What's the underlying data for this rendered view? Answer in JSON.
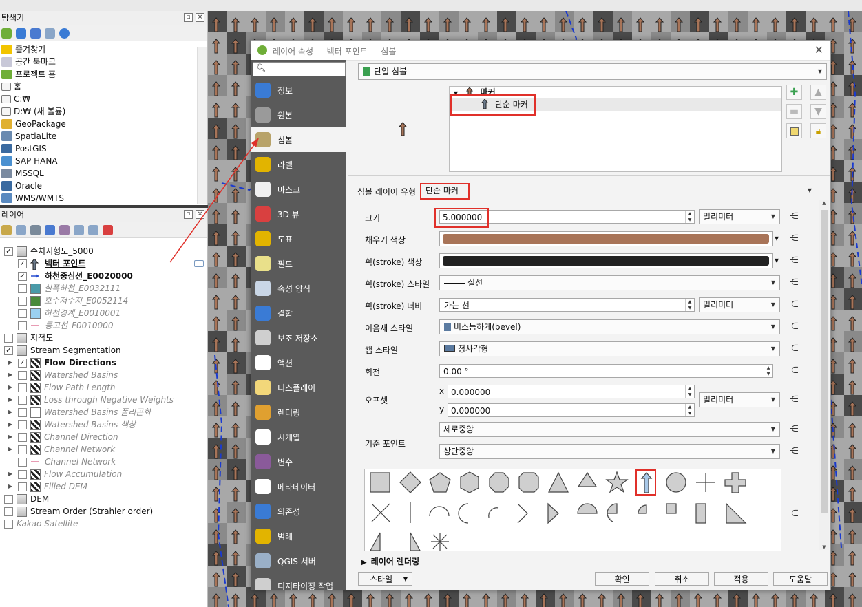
{
  "browser_panel": {
    "title": "탐색기",
    "items": [
      {
        "label": "즐겨찾기",
        "icon": "star-icon"
      },
      {
        "label": "공간 북마크",
        "icon": "bookmark-icon"
      },
      {
        "label": "프로젝트 홈",
        "icon": "project-home-icon"
      },
      {
        "label": "홈",
        "icon": "home-folder-icon"
      },
      {
        "label": "C:₩",
        "icon": "folder-icon"
      },
      {
        "label": "D:₩ (새 볼륨)",
        "icon": "folder-icon"
      },
      {
        "label": "GeoPackage",
        "icon": "geopackage-icon"
      },
      {
        "label": "SpatiaLite",
        "icon": "spatialite-icon"
      },
      {
        "label": "PostGIS",
        "icon": "postgis-icon"
      },
      {
        "label": "SAP HANA",
        "icon": "sap-hana-icon"
      },
      {
        "label": "MSSQL",
        "icon": "mssql-icon"
      },
      {
        "label": "Oracle",
        "icon": "oracle-icon"
      },
      {
        "label": "WMS/WMTS",
        "icon": "wms-icon"
      }
    ]
  },
  "layers_panel": {
    "title": "레이어",
    "layers": [
      {
        "label": "수치지형도_5000",
        "checked": true,
        "indent": 0,
        "caret": "",
        "icon": "group-icon",
        "style": ""
      },
      {
        "label": "벡터 포인트",
        "checked": true,
        "indent": 1,
        "caret": "",
        "icon": "arrow-marker-icon",
        "style": "bold-underline"
      },
      {
        "label": "하천중심선_E0020000",
        "checked": true,
        "indent": 1,
        "caret": "",
        "icon": "line-arrow-icon",
        "style": "bold"
      },
      {
        "label": "실폭하천_E0032111",
        "checked": false,
        "indent": 1,
        "caret": "",
        "icon": "teal-polygon-icon",
        "style": "grey-italic"
      },
      {
        "label": "호수저수지_E0052114",
        "checked": false,
        "indent": 1,
        "caret": "",
        "icon": "green-polygon-icon",
        "style": "grey-italic"
      },
      {
        "label": "하천경계_E0010001",
        "checked": false,
        "indent": 1,
        "caret": "",
        "icon": "lightblue-polygon-icon",
        "style": "grey-italic"
      },
      {
        "label": "등고선_F0010000",
        "checked": false,
        "indent": 1,
        "caret": "",
        "icon": "pink-line-icon",
        "style": "grey-italic"
      },
      {
        "label": "지적도",
        "checked": false,
        "indent": 0,
        "caret": "",
        "icon": "group-icon",
        "style": ""
      },
      {
        "label": "Stream Segmentation",
        "checked": true,
        "indent": 0,
        "caret": "",
        "icon": "group-icon",
        "style": ""
      },
      {
        "label": "Flow Directions",
        "checked": true,
        "indent": 1,
        "caret": "▶",
        "icon": "raster-icon",
        "style": "bold"
      },
      {
        "label": "Watershed Basins",
        "checked": false,
        "indent": 1,
        "caret": "▶",
        "icon": "raster-icon",
        "style": "grey-italic"
      },
      {
        "label": "Flow Path Length",
        "checked": false,
        "indent": 1,
        "caret": "▶",
        "icon": "raster-icon",
        "style": "grey-italic"
      },
      {
        "label": "Loss through Negative Weights",
        "checked": false,
        "indent": 1,
        "caret": "▶",
        "icon": "raster-icon",
        "style": "grey-italic"
      },
      {
        "label": "Watershed Basins 폴리곤화",
        "checked": false,
        "indent": 1,
        "caret": "▶",
        "icon": "white-polygon-icon",
        "style": "grey-italic"
      },
      {
        "label": "Watershed Basins 색상",
        "checked": false,
        "indent": 1,
        "caret": "▶",
        "icon": "raster-icon",
        "style": "grey-italic"
      },
      {
        "label": "Channel Direction",
        "checked": false,
        "indent": 1,
        "caret": "▶",
        "icon": "raster-icon",
        "style": "grey-italic"
      },
      {
        "label": "Channel Network",
        "checked": false,
        "indent": 1,
        "caret": "▶",
        "icon": "raster-icon",
        "style": "grey-italic"
      },
      {
        "label": "Channel Network",
        "checked": false,
        "indent": 1,
        "caret": "",
        "icon": "pink-line-icon",
        "style": "grey-italic"
      },
      {
        "label": "Flow Accumulation",
        "checked": false,
        "indent": 1,
        "caret": "▶",
        "icon": "raster-icon",
        "style": "grey-italic"
      },
      {
        "label": "Filled DEM",
        "checked": false,
        "indent": 1,
        "caret": "▶",
        "icon": "raster-icon",
        "style": "grey-italic"
      },
      {
        "label": "DEM",
        "checked": false,
        "indent": 0,
        "caret": "",
        "icon": "group-icon",
        "style": ""
      },
      {
        "label": "Stream Order (Strahler order)",
        "checked": false,
        "indent": 0,
        "caret": "",
        "icon": "group-icon",
        "style": ""
      },
      {
        "label": "Kakao Satellite",
        "checked": false,
        "indent": 0,
        "caret": "",
        "icon": "",
        "style": "grey-italic"
      }
    ]
  },
  "dialog": {
    "title": "레이어 속성 — 벡터 포인트 — 심볼",
    "nav": [
      {
        "label": "정보",
        "icon": "info-icon",
        "color": "#3a7bd5"
      },
      {
        "label": "원본",
        "icon": "source-tools-icon",
        "color": "#9a9a9a"
      },
      {
        "label": "심볼",
        "icon": "paintbrush-icon",
        "color": "#b8a36a"
      },
      {
        "label": "라벨",
        "icon": "label-abc-icon",
        "color": "#e2b400"
      },
      {
        "label": "마스크",
        "icon": "mask-abc-icon",
        "color": "#f0f0f0"
      },
      {
        "label": "3D 뷰",
        "icon": "cube-3d-icon",
        "color": "#d94040"
      },
      {
        "label": "도표",
        "icon": "diagram-icon",
        "color": "#e2b400"
      },
      {
        "label": "필드",
        "icon": "fields-icon",
        "color": "#e9e08a"
      },
      {
        "label": "속성 양식",
        "icon": "attribute-form-icon",
        "color": "#c9d6e6"
      },
      {
        "label": "결합",
        "icon": "join-icon",
        "color": "#3a7bd5"
      },
      {
        "label": "보조 저장소",
        "icon": "auxiliary-storage-icon",
        "color": "#cfcfcf"
      },
      {
        "label": "액션",
        "icon": "action-gear-icon",
        "color": "#ffffff"
      },
      {
        "label": "디스플레이",
        "icon": "display-bubble-icon",
        "color": "#f2d77a"
      },
      {
        "label": "렌더링",
        "icon": "rendering-brush-icon",
        "color": "#e0a030"
      },
      {
        "label": "시계열",
        "icon": "clock-icon",
        "color": "#ffffff"
      },
      {
        "label": "변수",
        "icon": "variable-epsilon-icon",
        "color": "#8a5a9a"
      },
      {
        "label": "메타데이터",
        "icon": "metadata-icon",
        "color": "#ffffff"
      },
      {
        "label": "의존성",
        "icon": "dependencies-icon",
        "color": "#3a7bd5"
      },
      {
        "label": "범례",
        "icon": "legend-icon",
        "color": "#e2b400"
      },
      {
        "label": "QGIS 서버",
        "icon": "qgis-server-icon",
        "color": "#9ab0c8"
      },
      {
        "label": "디지타이징 작업",
        "icon": "digitizing-icon",
        "color": "#cfcfcf"
      }
    ],
    "renderer": "단일 심볼",
    "tree": {
      "root": "마커",
      "child": "단순 마커"
    },
    "symbol_layer_type_label": "심볼 레이어 유형",
    "symbol_layer_type": "단순 마커",
    "size": {
      "label": "크기",
      "value": "5.000000",
      "unit": "밀리미터"
    },
    "fill_color": {
      "label": "채우기 색상",
      "color": "#a87458"
    },
    "stroke_color": {
      "label": "획(stroke) 색상",
      "color": "#222222"
    },
    "stroke_style": {
      "label": "획(stroke) 스타일",
      "value": "실선"
    },
    "stroke_width": {
      "label": "획(stroke) 너비",
      "value": "가는 선",
      "unit": "밀리미터"
    },
    "join_style": {
      "label": "이음새 스타일",
      "value": "비스듬하게(bevel)"
    },
    "cap_style": {
      "label": "캡 스타일",
      "value": "정사각형"
    },
    "rotation": {
      "label": "회전",
      "value": "0.00 °"
    },
    "offset": {
      "label": "오프셋",
      "x_label": "x",
      "x": "0.000000",
      "y_label": "y",
      "y": "0.000000",
      "unit": "밀리미터"
    },
    "anchor": {
      "label": "기준 포인트",
      "vertical": "세로중앙",
      "horizontal": "상단중앙"
    },
    "layer_rendering": "레이어 렌더링",
    "buttons": {
      "style": "스타일",
      "ok": "확인",
      "cancel": "취소",
      "apply": "적용",
      "help": "도움말"
    }
  }
}
